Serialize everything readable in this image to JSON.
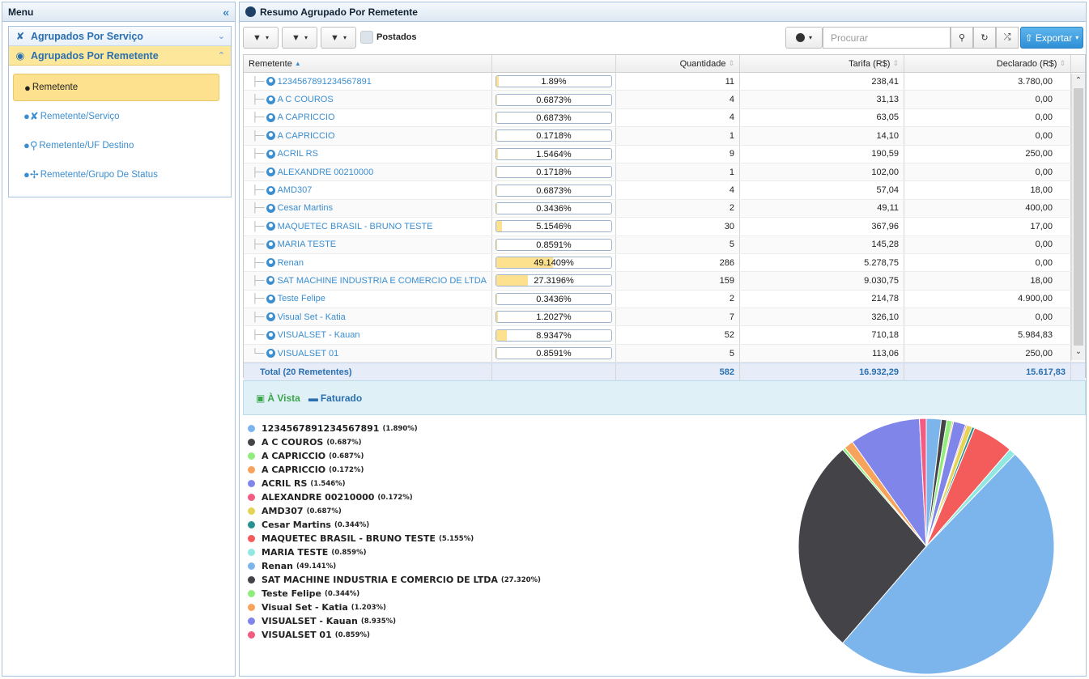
{
  "menu": {
    "title": "Menu",
    "collapse_icon": "«",
    "groups": [
      {
        "label": "Agrupados Por Serviço",
        "icon": "service-icon",
        "chevron": "⌄"
      },
      {
        "label": "Agrupados Por Remetente",
        "icon": "user-icon",
        "chevron": "⌃"
      }
    ],
    "items": [
      {
        "label": "Remetente",
        "selected": true
      },
      {
        "label": "Remetente/Serviço",
        "selected": false
      },
      {
        "label": "Remetente/UF Destino",
        "selected": false
      },
      {
        "label": "Remetente/Grupo De Status",
        "selected": false
      }
    ]
  },
  "main": {
    "title": "Resumo Agrupado Por Remetente",
    "toolbar": {
      "postados_label": "Postados",
      "search_placeholder": "Procurar",
      "export_label": "Exportar"
    },
    "grid": {
      "columns": [
        "Remetente",
        "",
        "Quantidade",
        "Tarifa (R$)",
        "Declarado (R$)"
      ],
      "rows": [
        {
          "name": "1234567891234567891",
          "pct_text": "1.89%",
          "pct": 1.89,
          "qty": "11",
          "tarifa": "238,41",
          "declarado": "3.780,00"
        },
        {
          "name": "A C COUROS",
          "pct_text": "0.6873%",
          "pct": 0.6873,
          "qty": "4",
          "tarifa": "31,13",
          "declarado": "0,00"
        },
        {
          "name": "A CAPRICCIO",
          "pct_text": "0.6873%",
          "pct": 0.6873,
          "qty": "4",
          "tarifa": "63,05",
          "declarado": "0,00"
        },
        {
          "name": "A CAPRICCIO",
          "pct_text": "0.1718%",
          "pct": 0.1718,
          "qty": "1",
          "tarifa": "14,10",
          "declarado": "0,00"
        },
        {
          "name": "ACRIL RS",
          "pct_text": "1.5464%",
          "pct": 1.5464,
          "qty": "9",
          "tarifa": "190,59",
          "declarado": "250,00"
        },
        {
          "name": "ALEXANDRE 00210000",
          "pct_text": "0.1718%",
          "pct": 0.1718,
          "qty": "1",
          "tarifa": "102,00",
          "declarado": "0,00"
        },
        {
          "name": "AMD307",
          "pct_text": "0.6873%",
          "pct": 0.6873,
          "qty": "4",
          "tarifa": "57,04",
          "declarado": "18,00"
        },
        {
          "name": "Cesar Martins",
          "pct_text": "0.3436%",
          "pct": 0.3436,
          "qty": "2",
          "tarifa": "49,11",
          "declarado": "400,00"
        },
        {
          "name": "MAQUETEC BRASIL - BRUNO TESTE",
          "pct_text": "5.1546%",
          "pct": 5.1546,
          "qty": "30",
          "tarifa": "367,96",
          "declarado": "17,00"
        },
        {
          "name": "MARIA TESTE",
          "pct_text": "0.8591%",
          "pct": 0.8591,
          "qty": "5",
          "tarifa": "145,28",
          "declarado": "0,00"
        },
        {
          "name": "Renan",
          "pct_text": "49.1409%",
          "pct": 49.1409,
          "qty": "286",
          "tarifa": "5.278,75",
          "declarado": "0,00"
        },
        {
          "name": "SAT MACHINE INDUSTRIA E COMERCIO DE LTDA",
          "pct_text": "27.3196%",
          "pct": 27.3196,
          "qty": "159",
          "tarifa": "9.030,75",
          "declarado": "18,00"
        },
        {
          "name": "Teste Felipe",
          "pct_text": "0.3436%",
          "pct": 0.3436,
          "qty": "2",
          "tarifa": "214,78",
          "declarado": "4.900,00"
        },
        {
          "name": "Visual Set - Katia",
          "pct_text": "1.2027%",
          "pct": 1.2027,
          "qty": "7",
          "tarifa": "326,10",
          "declarado": "0,00"
        },
        {
          "name": "VISUALSET - Kauan",
          "pct_text": "8.9347%",
          "pct": 8.9347,
          "qty": "52",
          "tarifa": "710,18",
          "declarado": "5.984,83"
        },
        {
          "name": "VISUALSET 01",
          "pct_text": "0.8591%",
          "pct": 0.8591,
          "qty": "5",
          "tarifa": "113,06",
          "declarado": "250,00"
        }
      ],
      "total": {
        "label": "Total (20 Remetentes)",
        "qty": "582",
        "tarifa": "16.932,29",
        "declarado": "15.617,83"
      }
    },
    "tabs": [
      {
        "label": "À Vista",
        "icon": "cash-icon",
        "color": "#3aa64a"
      },
      {
        "label": "Faturado",
        "icon": "credit-card-icon",
        "color": "#2a6fb0"
      }
    ]
  },
  "chart_data": {
    "type": "pie",
    "title": "",
    "slices": [
      {
        "label": "1234567891234567891",
        "pct_text": "(1.890%)",
        "value": 1.89,
        "color": "#7cb5ec"
      },
      {
        "label": "A C COUROS",
        "pct_text": "(0.687%)",
        "value": 0.687,
        "color": "#434348"
      },
      {
        "label": "A CAPRICCIO",
        "pct_text": "(0.687%)",
        "value": 0.687,
        "color": "#90ed7d"
      },
      {
        "label": "A CAPRICCIO",
        "pct_text": "(0.172%)",
        "value": 0.172,
        "color": "#f7a35c"
      },
      {
        "label": "ACRIL RS",
        "pct_text": "(1.546%)",
        "value": 1.546,
        "color": "#8085e9"
      },
      {
        "label": "ALEXANDRE 00210000",
        "pct_text": "(0.172%)",
        "value": 0.172,
        "color": "#f15c80"
      },
      {
        "label": "AMD307",
        "pct_text": "(0.687%)",
        "value": 0.687,
        "color": "#e4d354"
      },
      {
        "label": "Cesar Martins",
        "pct_text": "(0.344%)",
        "value": 0.344,
        "color": "#2b908f"
      },
      {
        "label": "MAQUETEC BRASIL - BRUNO TESTE",
        "pct_text": "(5.155%)",
        "value": 5.155,
        "color": "#f45b5b"
      },
      {
        "label": "MARIA TESTE",
        "pct_text": "(0.859%)",
        "value": 0.859,
        "color": "#91e8e1"
      },
      {
        "label": "Renan",
        "pct_text": "(49.141%)",
        "value": 49.141,
        "color": "#7cb5ec"
      },
      {
        "label": "SAT MACHINE INDUSTRIA E COMERCIO DE LTDA",
        "pct_text": "(27.320%)",
        "value": 27.32,
        "color": "#434348"
      },
      {
        "label": "Teste Felipe",
        "pct_text": "(0.344%)",
        "value": 0.344,
        "color": "#90ed7d"
      },
      {
        "label": "Visual Set - Katia",
        "pct_text": "(1.203%)",
        "value": 1.203,
        "color": "#f7a35c"
      },
      {
        "label": "VISUALSET - Kauan",
        "pct_text": "(8.935%)",
        "value": 8.935,
        "color": "#8085e9"
      },
      {
        "label": "VISUALSET 01",
        "pct_text": "(0.859%)",
        "value": 0.859,
        "color": "#f15c80"
      }
    ],
    "legend": "left"
  }
}
